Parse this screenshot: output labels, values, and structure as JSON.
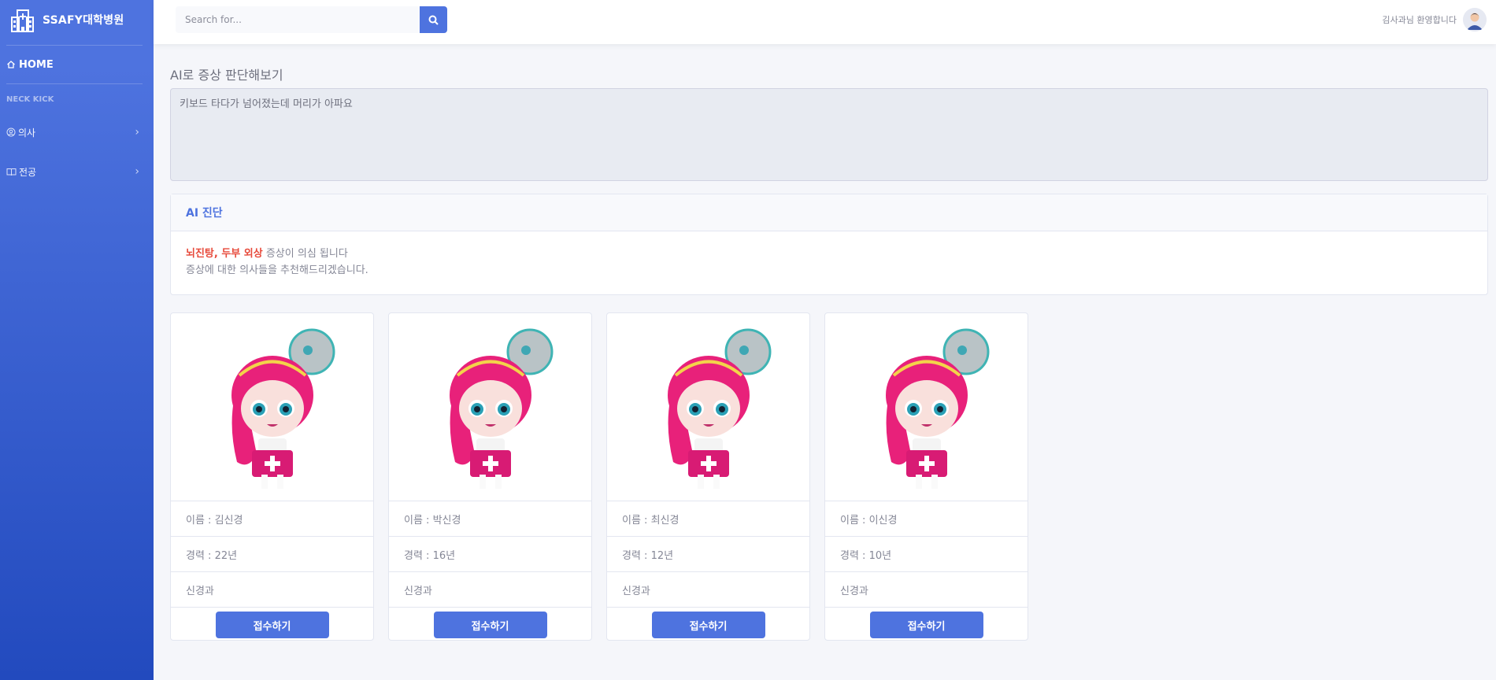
{
  "sidebar": {
    "brand": "SSAFY대학병원",
    "brand_icon": "hospital-icon",
    "home_label": "HOME",
    "heading": "NECK KICK",
    "items": [
      {
        "label": "의사",
        "icon": "user-circle-icon"
      },
      {
        "label": "전공",
        "icon": "book-icon"
      }
    ]
  },
  "topbar": {
    "search_placeholder": "Search for...",
    "user_greeting": "김사과님 환영합니다"
  },
  "main": {
    "title": "AI로 증상 판단해보기",
    "symptom_text": "키보드 타다가 넘어졌는데 머리가 아파요",
    "diagnosis": {
      "header": "AI 진단",
      "diseases": "뇌진탕, 두부 외상",
      "suffix": " 증상이 의심 됩니다",
      "recommend": "증상에 대한 의사들을 추천해드리겠습니다."
    },
    "doctors": [
      {
        "name": "이름 : 김신경",
        "career": "경력 : 22년",
        "dept": "신경과",
        "button": "접수하기"
      },
      {
        "name": "이름 : 박신경",
        "career": "경력 : 16년",
        "dept": "신경과",
        "button": "접수하기"
      },
      {
        "name": "이름 : 최신경",
        "career": "경력 : 12년",
        "dept": "신경과",
        "button": "접수하기"
      },
      {
        "name": "이름 : 이신경",
        "career": "경력 : 10년",
        "dept": "신경과",
        "button": "접수하기"
      }
    ]
  },
  "colors": {
    "primary": "#4e73df",
    "danger": "#e74a3b",
    "sidebar_top": "#4e73df",
    "sidebar_bottom": "#224abe"
  }
}
